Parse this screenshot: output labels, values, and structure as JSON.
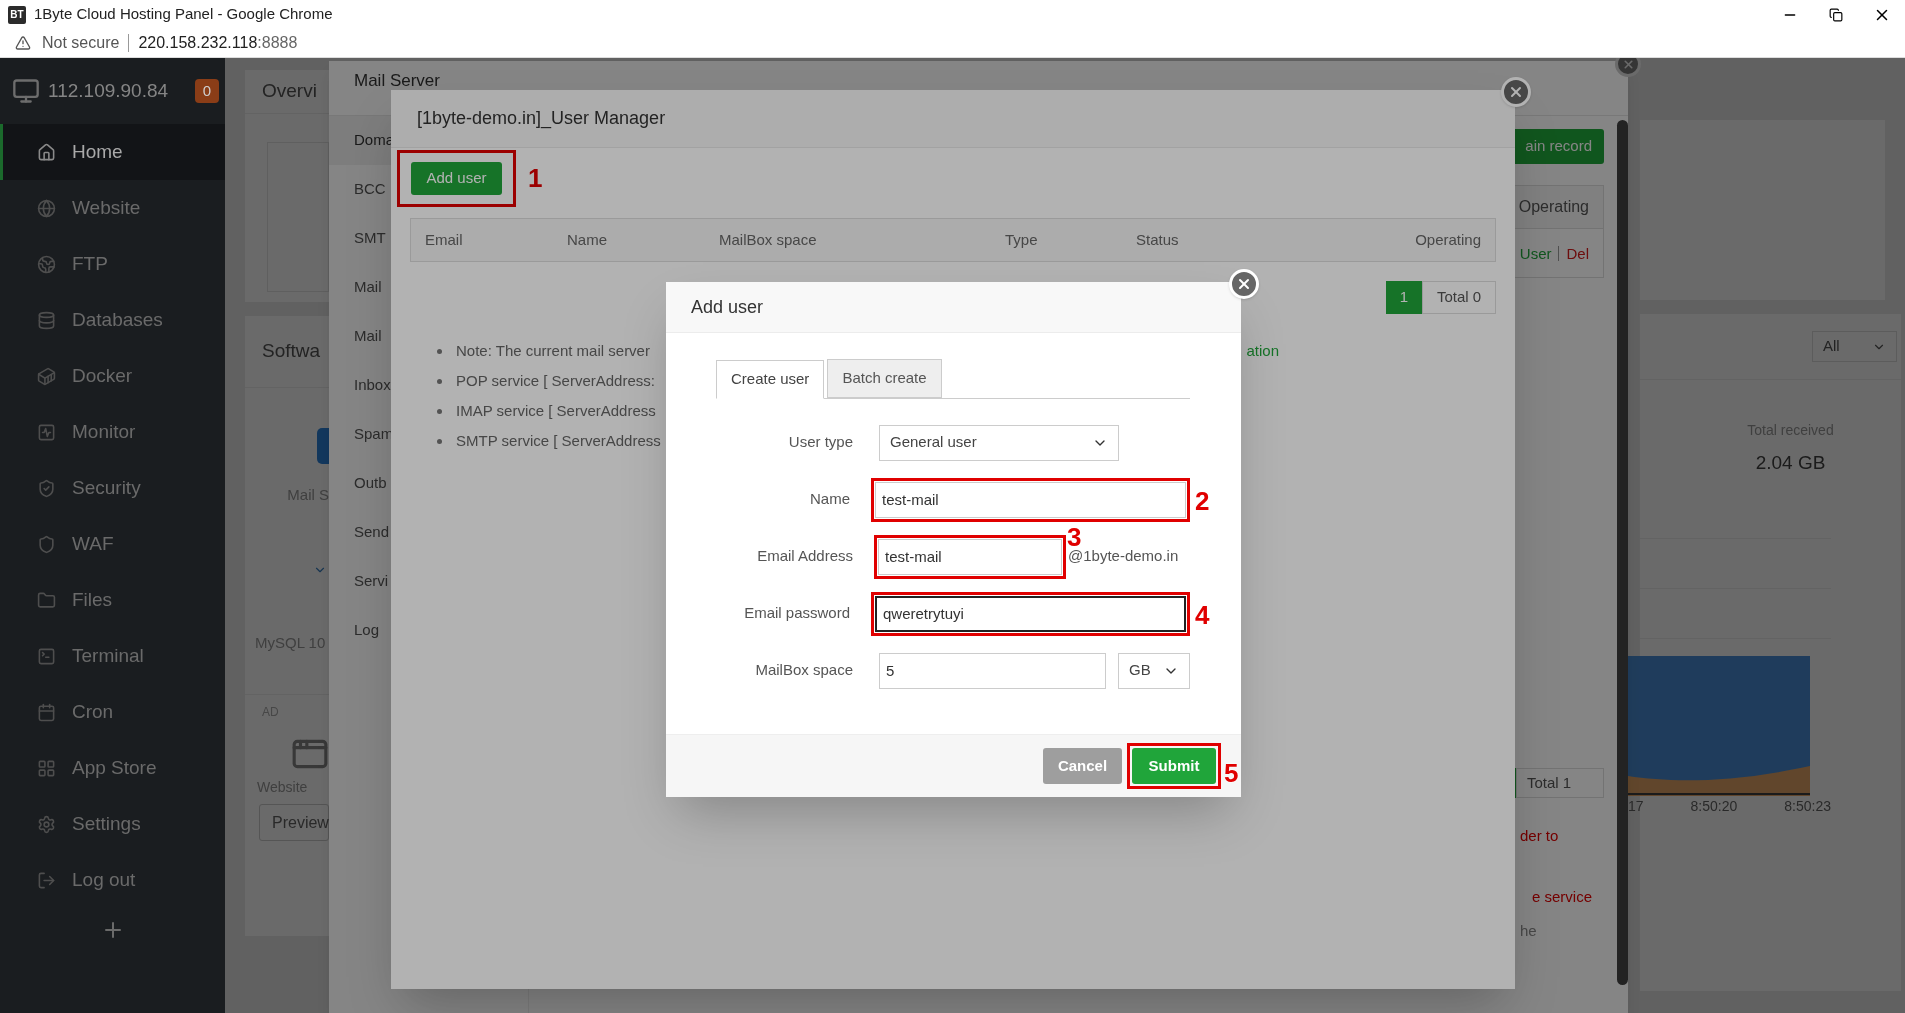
{
  "browser": {
    "app_icon": "BT",
    "title": "1Byte Cloud Hosting Panel - Google Chrome",
    "security_label": "Not secure",
    "url_host": "220.158.232.118",
    "url_port": ":8888"
  },
  "sidebar": {
    "server_ip": "112.109.90.84",
    "alert_count": "0",
    "items": [
      {
        "label": "Home",
        "selected": true
      },
      {
        "label": "Website",
        "selected": false
      },
      {
        "label": "FTP",
        "selected": false
      },
      {
        "label": "Databases",
        "selected": false
      },
      {
        "label": "Docker",
        "selected": false
      },
      {
        "label": "Monitor",
        "selected": false
      },
      {
        "label": "Security",
        "selected": false
      },
      {
        "label": "WAF",
        "selected": false
      },
      {
        "label": "Files",
        "selected": false
      },
      {
        "label": "Terminal",
        "selected": false
      },
      {
        "label": "Cron",
        "selected": false
      },
      {
        "label": "App Store",
        "selected": false
      },
      {
        "label": "Settings",
        "selected": false
      },
      {
        "label": "Log out",
        "selected": false
      }
    ]
  },
  "dashboard": {
    "overview_title": "Overvi",
    "software_title": "Softwa",
    "software_item": "Mail S",
    "mysql_label": "MySQL 10",
    "ad_label": "AD",
    "website_label": "Website",
    "preview_button": "Preview",
    "filter_select": "All",
    "total_received_label": "Total received",
    "total_received_value": "2.04 GB",
    "chart_time_labels": [
      "17",
      "8:50:20",
      "8:50:23"
    ]
  },
  "mail_server": {
    "title": "Mail Server",
    "menu": [
      {
        "label": "Doma",
        "selected": true
      },
      {
        "label": "BCC",
        "selected": false
      },
      {
        "label": "SMT",
        "selected": false
      },
      {
        "label": "Mail",
        "selected": false
      },
      {
        "label": "Mail",
        "selected": false
      },
      {
        "label": "Inbox",
        "selected": false
      },
      {
        "label": "Spam",
        "selected": false
      },
      {
        "label": "Outb",
        "selected": false
      },
      {
        "label": "Send",
        "selected": false
      },
      {
        "label": "Servi",
        "selected": false
      },
      {
        "label": "Log",
        "selected": false
      }
    ],
    "domain_record_button": "ain record",
    "table_header": "Operating",
    "row_actions": [
      {
        "label": "User",
        "kind": "link"
      },
      {
        "label": "Del",
        "kind": "danger"
      }
    ],
    "page_total": "Total 1",
    "notes": [
      {
        "text": "der to",
        "kind": "warning"
      },
      {
        "text": "e service",
        "kind": "warning"
      },
      {
        "text": "he",
        "kind": "plain"
      }
    ]
  },
  "user_manager": {
    "title": "[1byte-demo.in]_User Manager",
    "add_button": {
      "label": "Add user",
      "step": "1"
    },
    "columns": [
      "Email",
      "Name",
      "MailBox space",
      "Type",
      "Status",
      "Operating"
    ],
    "pagination": {
      "current": "1",
      "total": "Total 0"
    },
    "notes": [
      {
        "text": "Note: The current mail server",
        "tail": "ation"
      },
      {
        "text": "POP service [ ServerAddress:"
      },
      {
        "text": "IMAP service [ ServerAddress"
      },
      {
        "text": "SMTP service [ ServerAddress"
      }
    ]
  },
  "add_user": {
    "title": "Add user",
    "tabs": [
      {
        "label": "Create user",
        "selected": true
      },
      {
        "label": "Batch create",
        "selected": false
      }
    ],
    "fields": [
      {
        "label": "User type",
        "kind": "select",
        "value": "General user",
        "focused": false
      },
      {
        "label": "Name",
        "kind": "text",
        "value": "test-mail",
        "focused": false,
        "step": "2"
      },
      {
        "label": "Email Address",
        "kind": "text",
        "value": "test-mail",
        "suffix": "@1byte-demo.in",
        "focused": false,
        "step": "3"
      },
      {
        "label": "Email password",
        "kind": "text",
        "value": "qweretrytuyi",
        "focused": true,
        "step": "4"
      },
      {
        "label": "MailBox space",
        "kind": "number",
        "value": "5",
        "unit": "GB",
        "focused": false
      }
    ],
    "cancel_button": "Cancel",
    "submit_button": {
      "label": "Submit",
      "step": "5"
    }
  }
}
